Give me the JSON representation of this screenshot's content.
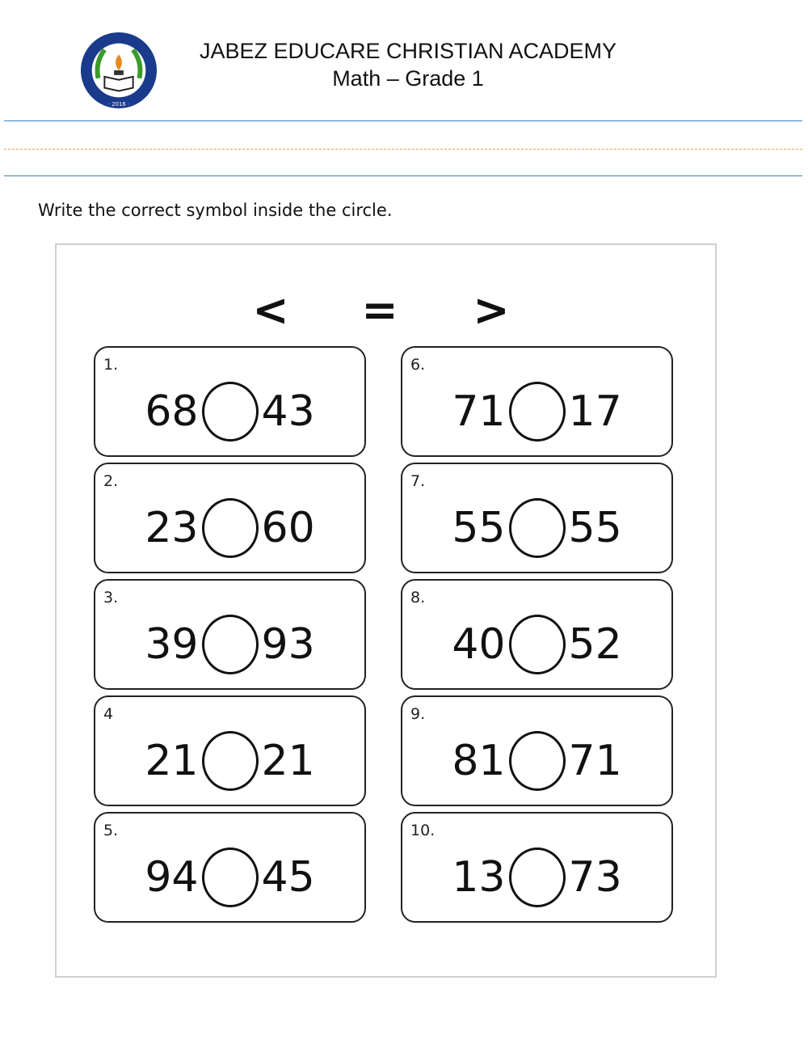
{
  "header": {
    "school": "JABEZ EDUCARE CHRISTIAN ACADEMY",
    "subject": "Math – Grade 1",
    "logo_text": "JABEZ EDUCARE CHRISTIAN ACADEMY 2016"
  },
  "instruction": "Write the correct symbol inside the circle.",
  "symbols": [
    "<",
    "=",
    ">"
  ],
  "items": [
    {
      "label": "1.",
      "a": "68",
      "b": "43"
    },
    {
      "label": "2.",
      "a": "23",
      "b": "60"
    },
    {
      "label": "3.",
      "a": "39",
      "b": "93"
    },
    {
      "label": "4",
      "a": "21",
      "b": "21"
    },
    {
      "label": "5.",
      "a": "94",
      "b": "45"
    },
    {
      "label": "6.",
      "a": "71",
      "b": "17"
    },
    {
      "label": "7.",
      "a": "55",
      "b": "55"
    },
    {
      "label": "8.",
      "a": "40",
      "b": "52"
    },
    {
      "label": "9.",
      "a": "81",
      "b": "71"
    },
    {
      "label": "10.",
      "a": "13",
      "b": "73"
    }
  ],
  "colors": {
    "rule_blue": "#3d7fc4",
    "rule_orange": "#e8a050"
  }
}
